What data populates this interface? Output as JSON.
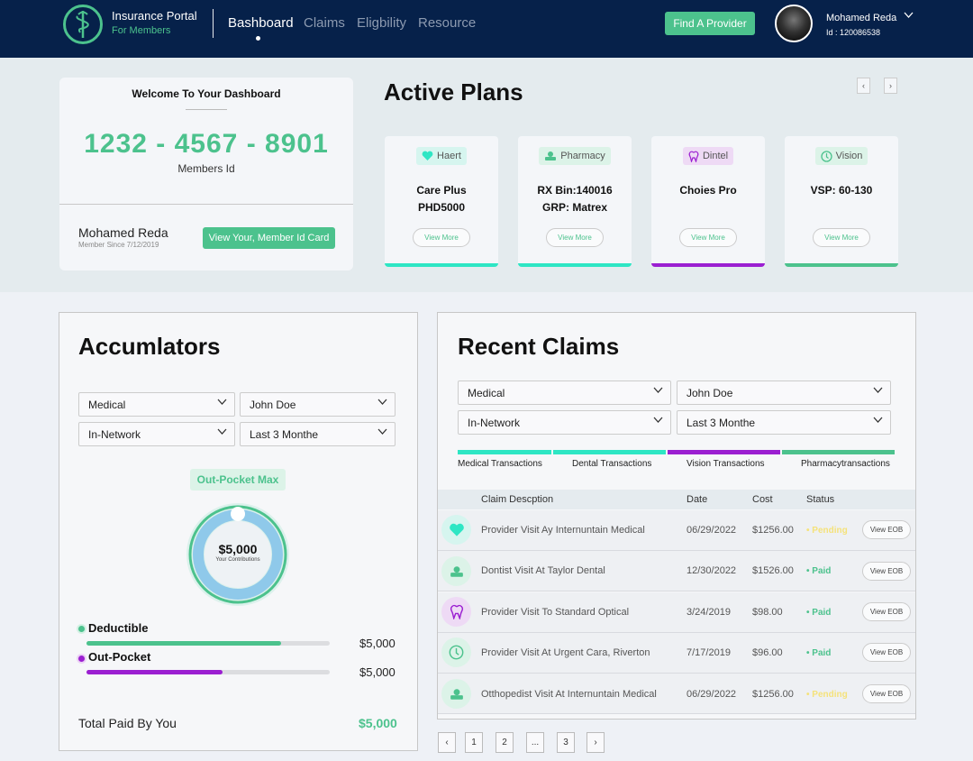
{
  "header": {
    "brand_title": "Insurance Portal",
    "brand_subtitle": "For Members",
    "nav": [
      "Bashboard",
      "Claims",
      "Eligbility",
      "Resource"
    ],
    "find_provider": "Find A Provider",
    "user_name": "Mohamed Reda",
    "user_id": "Id : 120086538"
  },
  "welcome": {
    "title": "Welcome To Your Dashboard",
    "member_number": "1232 - 4567 - 8901",
    "member_label": "Members Id",
    "name": "Mohamed Reda",
    "since": "Member Since 7/12/2019",
    "id_card_button": "View Your, Member Id Card"
  },
  "active_plans": {
    "title": "Active Plans",
    "prev": "‹",
    "next": "›",
    "plans": [
      {
        "badge": "Haert",
        "line1": "Care Plus",
        "line2": "PHD5000",
        "view": "View More",
        "color": "#2ee6c4",
        "icon": "heart-icon"
      },
      {
        "badge": "Pharmacy",
        "line1": "RX Bin:140016",
        "line2": "GRP: Matrex",
        "view": "View More",
        "color": "#2ee6c4",
        "icon": "pharmacy-icon"
      },
      {
        "badge": "Dintel",
        "line1": "Choies Pro",
        "line2": "",
        "view": "View More",
        "color": "#9b1fd1",
        "icon": "tooth-icon"
      },
      {
        "badge": "Vision",
        "line1": "VSP: 60-130",
        "line2": "",
        "view": "View More",
        "color": "#4cc28d",
        "icon": "vision-icon"
      }
    ]
  },
  "accumulators": {
    "title": "Accumlators",
    "selects": [
      "Medical",
      "John Doe",
      "In-Network",
      "Last 3 Monthe"
    ],
    "badge": "Out-Pocket Max",
    "gauge_amount": "$5,000",
    "gauge_sub": "Your Contributions",
    "items": [
      {
        "label": "Deductible",
        "amount": "$5,000",
        "progress": 0.8,
        "color": "#4cc28d"
      },
      {
        "label": "Out-Pocket",
        "amount": "$5,000",
        "progress": 0.56,
        "color": "#9b1fd1"
      }
    ],
    "total_label": "Total Paid By You",
    "total_value": "$5,000"
  },
  "recent_claims": {
    "title": "Recent Claims",
    "selects": [
      "Medical",
      "John Doe",
      "In-Network",
      "Last 3 Monthe"
    ],
    "tabs": [
      {
        "label": "Medical Transactions",
        "color": "#2ee6c4"
      },
      {
        "label": "Dental Transactions",
        "color": "#2ee6c4"
      },
      {
        "label": "Vision Transactions",
        "color": "#9b1fd1"
      },
      {
        "label": "Pharmacytransactions",
        "color": "#4cc28d"
      }
    ],
    "columns": [
      "Claim Descption",
      "Date",
      "Cost",
      "Status"
    ],
    "rows": [
      {
        "desc": "Provider Visit Ay Internuntain Medical",
        "date": "06/29/2022",
        "cost": "$1256.00",
        "status": "• Pending",
        "status_color": "#f5e27a",
        "eob": "View EOB",
        "icon": "heart-icon"
      },
      {
        "desc": "Dontist Visit At Taylor Dental",
        "date": "12/30/2022",
        "cost": "$1526.00",
        "status": "• Paid",
        "status_color": "#4cc28d",
        "eob": "View EOB",
        "icon": "pharmacy-icon"
      },
      {
        "desc": "Provider Visit To Standard Optical",
        "date": "3/24/2019",
        "cost": "$98.00",
        "status": "• Paid",
        "status_color": "#4cc28d",
        "eob": "View EOB",
        "icon": "tooth-icon"
      },
      {
        "desc": "Provider Visit At Urgent Cara, Riverton",
        "date": "7/17/2019",
        "cost": "$96.00",
        "status": "• Paid",
        "status_color": "#4cc28d",
        "eob": "View EOB",
        "icon": "vision-icon"
      },
      {
        "desc": "Otthopedist Visit At Internuntain Medical",
        "date": "06/29/2022",
        "cost": "$1256.00",
        "status": "• Pending",
        "status_color": "#f5e27a",
        "eob": "View EOB",
        "icon": "pharmacy-icon"
      }
    ],
    "pagination": [
      "‹",
      "1",
      "2",
      "...",
      "3",
      "›"
    ]
  }
}
